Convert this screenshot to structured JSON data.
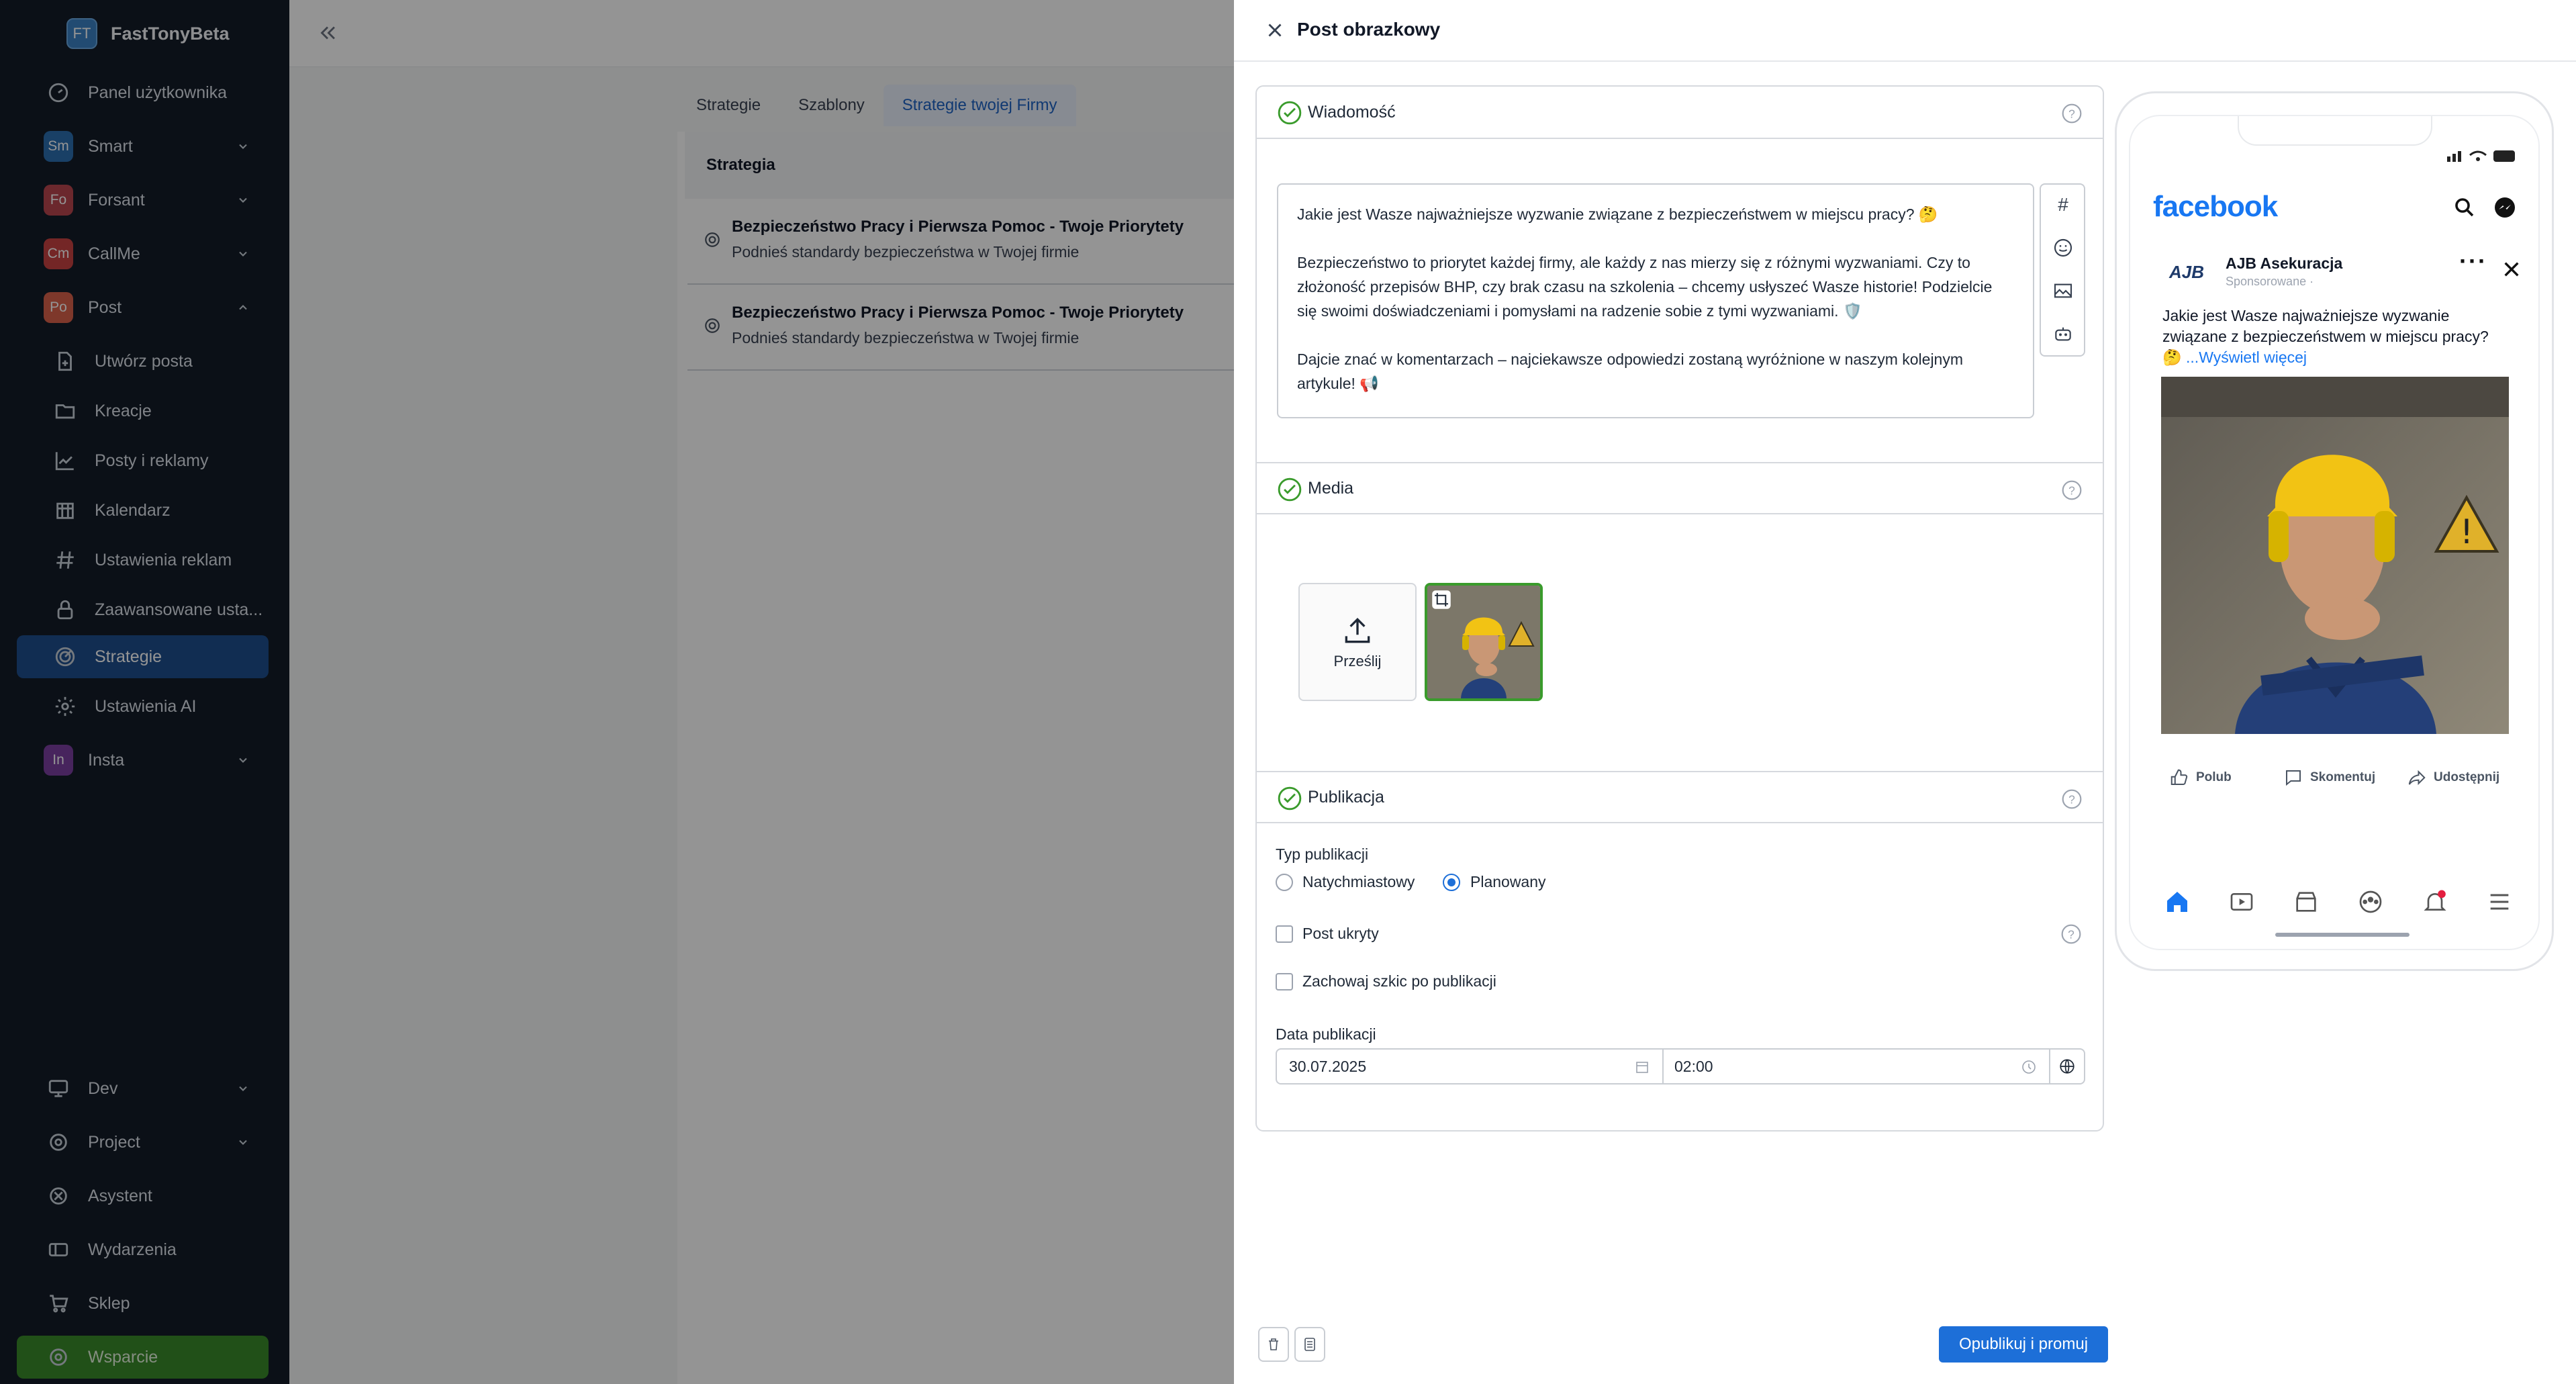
{
  "brand": {
    "logo": "FT",
    "name": "FastTonyBeta",
    "color": "#3b82c4"
  },
  "sidebar": {
    "items": [
      {
        "label": "Panel użytkownika",
        "icon": "dashboard-icon"
      },
      {
        "label": "Smart",
        "badge": "Sm",
        "badge_color": "#2c6fb0"
      },
      {
        "label": "Forsant",
        "badge": "Fo",
        "badge_color": "#b8454f"
      },
      {
        "label": "CallMe",
        "badge": "Cm",
        "badge_color": "#c94343"
      },
      {
        "label": "Post",
        "badge": "Po",
        "badge_color": "#d9614a"
      },
      {
        "label": "Utwórz posta",
        "icon": "file-plus-icon"
      },
      {
        "label": "Kreacje",
        "icon": "folder-icon"
      },
      {
        "label": "Posty i reklamy",
        "icon": "chart-line-icon"
      },
      {
        "label": "Kalendarz",
        "icon": "calendar-icon"
      },
      {
        "label": "Ustawienia reklam",
        "icon": "hash-icon"
      },
      {
        "label": "Zaawansowane usta...",
        "icon": "lock-icon"
      },
      {
        "label": "Strategie",
        "icon": "target-icon"
      },
      {
        "label": "Ustawienia AI",
        "icon": "gear-icon"
      },
      {
        "label": "Insta",
        "badge": "In",
        "badge_color": "#7a3fa0"
      },
      {
        "label": "Dev",
        "icon": "monitor-icon"
      },
      {
        "label": "Project",
        "icon": "gear-icon"
      },
      {
        "label": "Asystent",
        "icon": "openai-icon"
      },
      {
        "label": "Wydarzenia",
        "icon": "ticket-icon"
      },
      {
        "label": "Sklep",
        "icon": "cart-icon"
      },
      {
        "label": "Wsparcie",
        "icon": "support-icon"
      }
    ]
  },
  "main": {
    "tabs": [
      "Strategie",
      "Szablony",
      "Strategie twojej Firmy"
    ],
    "active_tab": "Strategie twojej Firmy",
    "table_header": "Strategia",
    "rows": [
      {
        "title": "Bezpieczeństwo Pracy i Pierwsza Pomoc - Twoje Priorytety",
        "subtitle": "Podnieś standardy bezpieczeństwa w Twojej firmie"
      },
      {
        "title": "Bezpieczeństwo Pracy i Pierwsza Pomoc - Twoje Priorytety",
        "subtitle": "Podnieś standardy bezpieczeństwa w Twojej firmie"
      }
    ]
  },
  "drawer": {
    "title": "Post obrazkowy",
    "sections": {
      "message": "Wiadomość",
      "media": "Media",
      "publication": "Publikacja"
    },
    "message_paragraphs": [
      "Jakie jest Wasze najważniejsze wyzwanie związane z bezpieczeństwem w miejscu pracy? 🤔",
      "Bezpieczeństwo to priorytet każdej firmy, ale każdy z nas mierzy się z różnymi wyzwaniami. Czy to złożoność przepisów BHP, czy brak czasu na szkolenia – chcemy usłyszeć Wasze historie! Podzielcie się swoimi doświadczeniami i pomysłami na radzenie sobie z tymi wyzwaniami. 🛡️",
      "Dajcie znać w komentarzach – najciekawsze odpowiedzi zostaną wyróżnione w naszym kolejnym artykule! 📢"
    ],
    "upload_label": "Prześlij",
    "publication_type_label": "Typ publikacji",
    "publication_types": [
      "Natychmiastowy",
      "Planowany"
    ],
    "selected_publication_type": "Planowany",
    "hidden_post_label": "Post ukryty",
    "keep_draft_label": "Zachowaj szkic po publikacji",
    "date_label": "Data publikacji",
    "date_value": "30.07.2025",
    "time_value": "02:00",
    "publish_button": "Opublikuj i promuj"
  },
  "preview": {
    "platform_logo": "facebook",
    "page_name": "AJB Asekuracja",
    "page_avatar_text": "AJB",
    "sponsored": "Sponsorowane ·",
    "post_text": "Jakie jest Wasze najważniejsze wyzwanie związane z bezpieczeństwem w miejscu pracy? 🤔",
    "see_more": "...Wyświetl więcej",
    "actions": [
      "Polub",
      "Skomentuj",
      "Udostępnij"
    ]
  },
  "colors": {
    "sidebar_bg": "#131c28",
    "accent": "#1d6fd8",
    "active_nav": "#1e4f8e",
    "support": "#3a8a2a",
    "success_check": "#3a9b2c",
    "facebook": "#1877f2"
  }
}
